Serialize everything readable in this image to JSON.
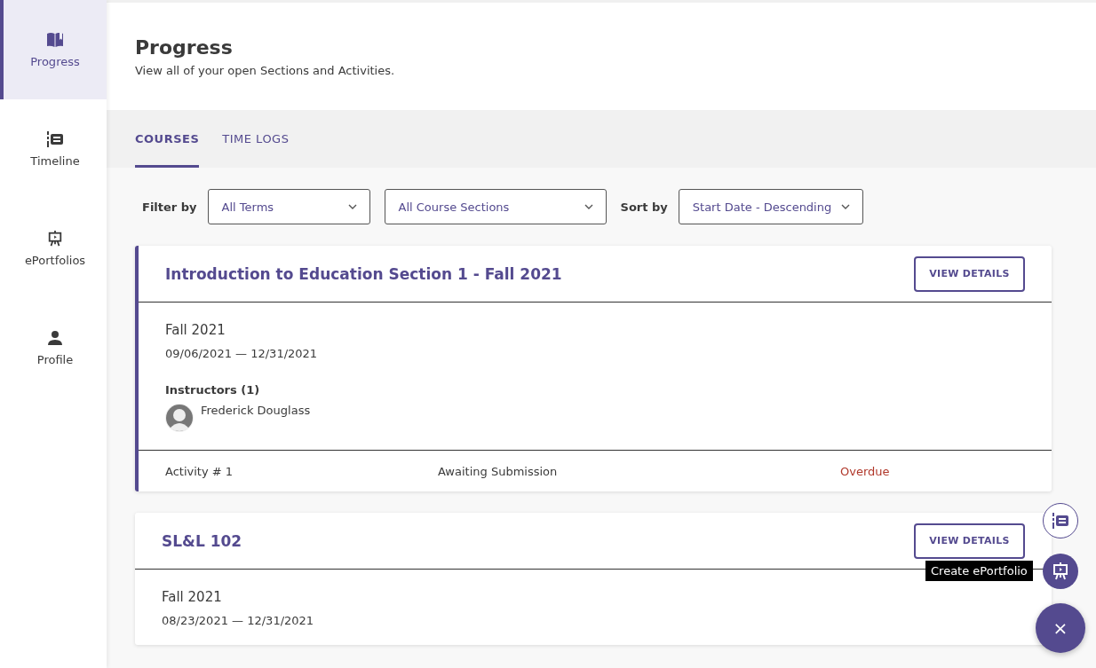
{
  "sidebar": {
    "items": [
      {
        "label": "Progress",
        "selected": true
      },
      {
        "label": "Timeline",
        "selected": false
      },
      {
        "label": "ePortfolios",
        "selected": false
      },
      {
        "label": "Profile",
        "selected": false
      }
    ]
  },
  "header": {
    "title": "Progress",
    "subtitle": "View all of your open Sections and Activities."
  },
  "tabs": [
    {
      "label": "COURSES",
      "selected": true
    },
    {
      "label": "TIME LOGS",
      "selected": false
    }
  ],
  "filters": {
    "filter_label": "Filter by",
    "term": "All Terms",
    "section": "All Course Sections",
    "sort_label": "Sort by",
    "sort": "Start Date - Descending"
  },
  "courses": [
    {
      "title": "Introduction to Education Section 1 - Fall 2021",
      "highlighted": true,
      "button": "VIEW DETAILS",
      "term": "Fall 2021",
      "dates": "09/06/2021 — 12/31/2021",
      "instructors_label": "Instructors (1)",
      "instructors": [
        "Frederick Douglass"
      ],
      "activities": [
        {
          "name": "Activity # 1",
          "status": "Awaiting Submission",
          "due": "Overdue"
        }
      ]
    },
    {
      "title": "SL&L 102",
      "highlighted": false,
      "button": "VIEW DETAILS",
      "term": "Fall 2021",
      "dates": "08/23/2021 — 12/31/2021"
    }
  ],
  "fab": {
    "tooltip": "Create ePortfolio",
    "close": "×"
  }
}
